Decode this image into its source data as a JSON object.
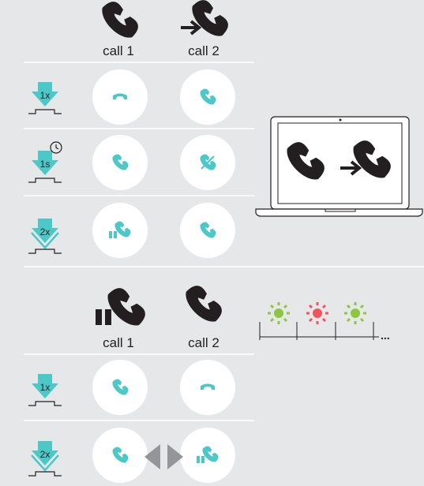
{
  "header_top": {
    "call1_label": "call 1",
    "call2_label": "call 2"
  },
  "header_bottom": {
    "call1_label": "call 1",
    "call2_label": "call 2"
  },
  "button_press_labels": {
    "single": "1x",
    "long": "1s",
    "double": "2x"
  },
  "rows_top": [
    {
      "press": "1x",
      "call1_action": "end-call",
      "call2_action": "accept-call"
    },
    {
      "press": "1s",
      "call1_action": "accept-call",
      "call2_action": "reject-call"
    },
    {
      "press": "2x",
      "call1_action": "hold-call",
      "call2_action": "accept-call"
    }
  ],
  "rows_bottom": [
    {
      "press": "1x",
      "call1_action": "accept-call",
      "call2_action": "end-call"
    },
    {
      "press": "2x",
      "call1_action": "accept-call",
      "call2_action": "hold-call",
      "between": "swap-arrows-icon"
    }
  ],
  "led_sequence": [
    "green",
    "red",
    "green"
  ],
  "led_trailing": "...",
  "colors": {
    "background": "#e6e7e8",
    "teal": "#4cc8c8",
    "dark": "#231f20",
    "led_green": "#8dc63f",
    "led_red": "#f2545b",
    "white": "#ffffff",
    "grey": "#939598"
  }
}
